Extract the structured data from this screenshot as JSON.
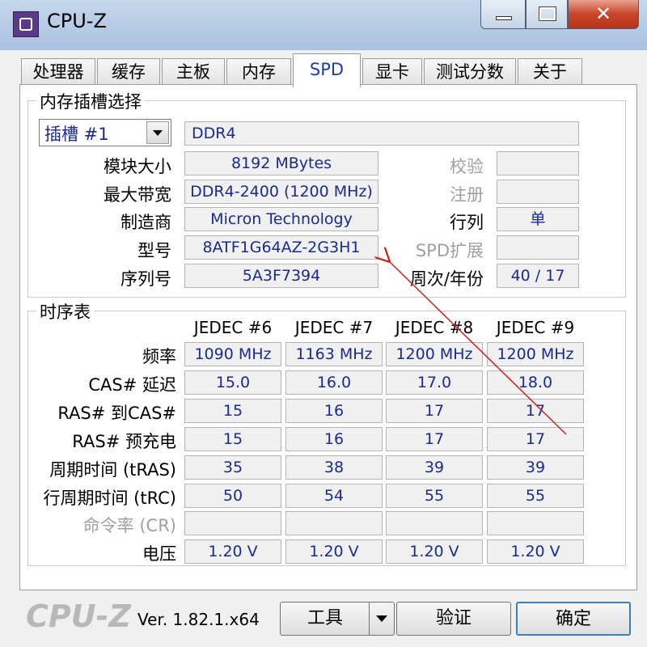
{
  "window": {
    "title": "CPU-Z"
  },
  "tabs": [
    "处理器",
    "缓存",
    "主板",
    "内存",
    "SPD",
    "显卡",
    "测试分数",
    "关于"
  ],
  "memory_slot": {
    "group_title": "内存插槽选择",
    "slot_selected": "插槽 #1",
    "type": "DDR4",
    "labels": {
      "module_size": "模块大小",
      "max_bandwidth": "最大带宽",
      "manufacturer": "制造商",
      "part_number": "型号",
      "serial": "序列号",
      "correction": "校验",
      "registered": "注册",
      "ranks": "行列",
      "spd_ext": "SPD扩展",
      "week_year": "周次/年份"
    },
    "values": {
      "module_size": "8192 MBytes",
      "max_bandwidth": "DDR4-2400 (1200 MHz)",
      "manufacturer": "Micron Technology",
      "part_number": "8ATF1G64AZ-2G3H1",
      "serial": "5A3F7394",
      "correction": "",
      "registered": "",
      "ranks": "单",
      "spd_ext": "",
      "week_year": "40 / 17"
    }
  },
  "timings": {
    "group_title": "时序表",
    "columns": [
      "JEDEC #6",
      "JEDEC #7",
      "JEDEC #8",
      "JEDEC #9"
    ],
    "rows": [
      {
        "label": "频率",
        "values": [
          "1090 MHz",
          "1163 MHz",
          "1200 MHz",
          "1200 MHz"
        ]
      },
      {
        "label": "CAS# 延迟",
        "values": [
          "15.0",
          "16.0",
          "17.0",
          "18.0"
        ]
      },
      {
        "label": "RAS# 到CAS#",
        "values": [
          "15",
          "16",
          "17",
          "17"
        ]
      },
      {
        "label": "RAS# 预充电",
        "values": [
          "15",
          "16",
          "17",
          "17"
        ]
      },
      {
        "label": "周期时间 (tRAS)",
        "values": [
          "35",
          "38",
          "39",
          "39"
        ]
      },
      {
        "label": "行周期时间 (tRC)",
        "values": [
          "50",
          "54",
          "55",
          "55"
        ]
      },
      {
        "label": "命令率 (CR)",
        "values": [
          "",
          "",
          "",
          ""
        ]
      },
      {
        "label": "电压",
        "values": [
          "1.20 V",
          "1.20 V",
          "1.20 V",
          "1.20 V"
        ]
      }
    ]
  },
  "footer": {
    "logo": "CPU-Z",
    "version": "Ver. 1.82.1.x64",
    "tools": "工具",
    "validate": "验证",
    "ok": "确定"
  }
}
